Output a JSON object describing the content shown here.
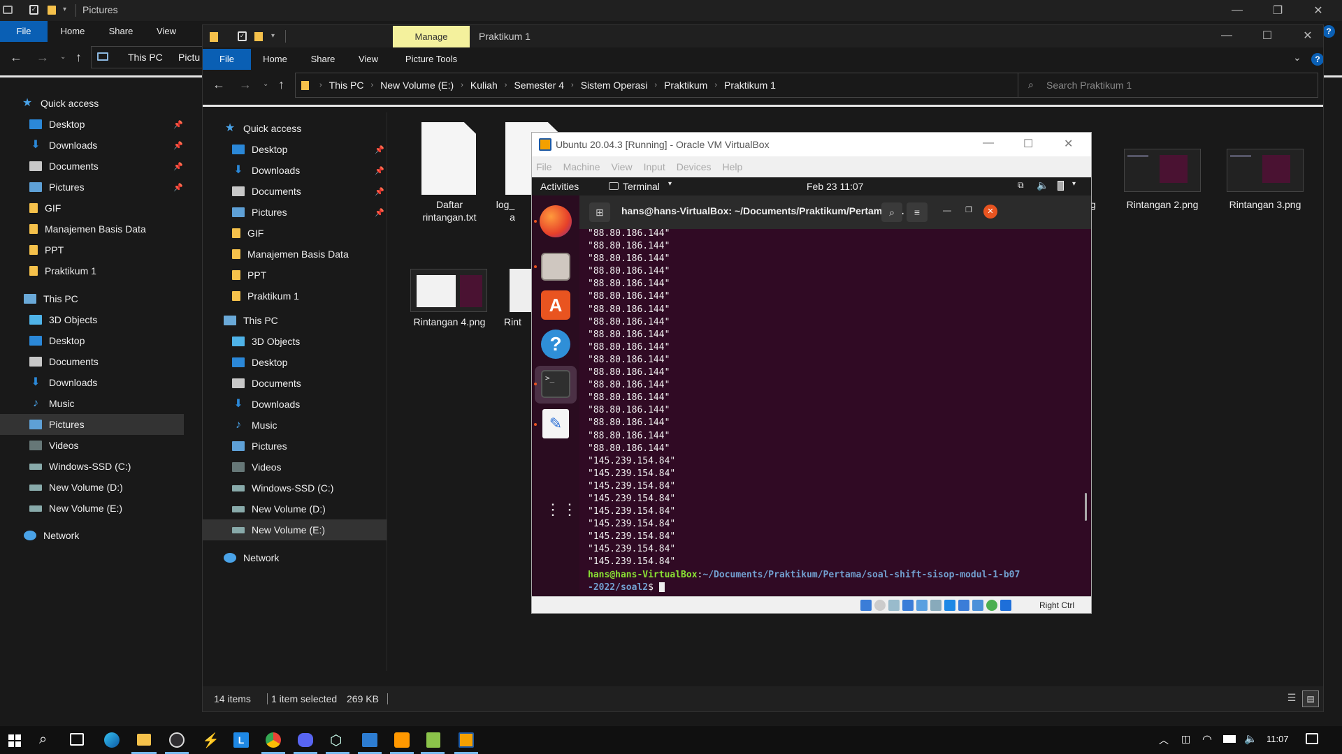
{
  "back_window": {
    "title": "Pictures",
    "tabs": [
      "File",
      "Home",
      "Share",
      "View"
    ],
    "crumbs": [
      "This PC",
      "Pictu"
    ],
    "sidebar": {
      "quick_access": "Quick access",
      "quick_items": [
        "Desktop",
        "Downloads",
        "Documents",
        "Pictures",
        "GIF",
        "Manajemen Basis Data",
        "PPT",
        "Praktikum 1"
      ],
      "this_pc": "This PC",
      "pc_items": [
        "3D Objects",
        "Desktop",
        "Documents",
        "Downloads",
        "Music",
        "Pictures",
        "Videos",
        "Windows-SSD (C:)",
        "New Volume (D:)",
        "New Volume (E:)"
      ],
      "network": "Network"
    }
  },
  "front_window": {
    "manage_label": "Manage",
    "title": "Praktikum 1",
    "tabs": [
      "File",
      "Home",
      "Share",
      "View",
      "Picture Tools"
    ],
    "crumbs": [
      "This PC",
      "New Volume (E:)",
      "Kuliah",
      "Semester 4",
      "Sistem Operasi",
      "Praktikum",
      "Praktikum 1"
    ],
    "search_placeholder": "Search Praktikum 1",
    "sidebar": {
      "quick_access": "Quick access",
      "quick_items": [
        "Desktop",
        "Downloads",
        "Documents",
        "Pictures",
        "GIF",
        "Manajemen Basis Data",
        "PPT",
        "Praktikum 1"
      ],
      "this_pc": "This PC",
      "pc_items": [
        "3D Objects",
        "Desktop",
        "Documents",
        "Downloads",
        "Music",
        "Pictures",
        "Videos",
        "Windows-SSD (C:)",
        "New Volume (D:)",
        "New Volume (E:)"
      ],
      "network": "Network"
    },
    "files": {
      "f1_line1": "Daftar",
      "f1_line2": "rintangan.txt",
      "f2_a": "log_",
      "f2_b": "a",
      "f3": "g",
      "f4": "Rintangan 2.png",
      "f5": "Rintangan 3.png",
      "f6": "Rintangan 4.png",
      "f7": "Rint"
    },
    "status": {
      "items": "14 items",
      "selected": "1 item selected",
      "size": "269 KB"
    }
  },
  "vbox": {
    "title": "Ubuntu 20.04.3 [Running] - Oracle VM VirtualBox",
    "menu": [
      "File",
      "Machine",
      "View",
      "Input",
      "Devices",
      "Help"
    ],
    "host_key": "Right Ctrl"
  },
  "ubuntu": {
    "activities": "Activities",
    "app_menu": "Terminal",
    "clock": "Feb 23  11:07",
    "terminal_title": "hans@hans-VirtualBox: ~/Documents/Praktikum/Pertama/s...",
    "output_lines": [
      "\"88.80.186.144\"",
      "\"88.80.186.144\"",
      "\"88.80.186.144\"",
      "\"88.80.186.144\"",
      "\"88.80.186.144\"",
      "\"88.80.186.144\"",
      "\"88.80.186.144\"",
      "\"88.80.186.144\"",
      "\"88.80.186.144\"",
      "\"88.80.186.144\"",
      "\"88.80.186.144\"",
      "\"88.80.186.144\"",
      "\"88.80.186.144\"",
      "\"88.80.186.144\"",
      "\"88.80.186.144\"",
      "\"88.80.186.144\"",
      "\"88.80.186.144\"",
      "\"88.80.186.144\"",
      "\"145.239.154.84\"",
      "\"145.239.154.84\"",
      "\"145.239.154.84\"",
      "\"145.239.154.84\"",
      "\"145.239.154.84\"",
      "\"145.239.154.84\"",
      "\"145.239.154.84\"",
      "\"145.239.154.84\"",
      "\"145.239.154.84\""
    ],
    "prompt_user": "hans@hans-VirtualBox",
    "prompt_path": "~/Documents/Praktikum/Pertama/soal-shift-sisop-modul-1-b07",
    "prompt_path2": "-2022/soal2",
    "prompt_end": "$ "
  },
  "taskbar": {
    "time": "11:07"
  }
}
